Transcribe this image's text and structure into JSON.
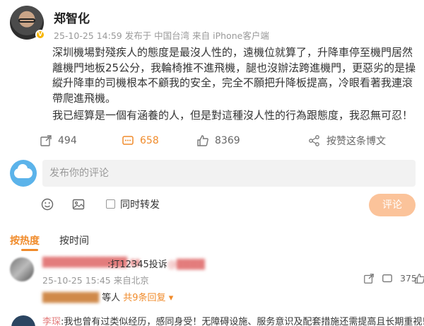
{
  "post": {
    "username": "郑智化",
    "meta": "25-10-25 14:59 发布于 中国台湾 来自 iPhone客户端",
    "paragraphs": [
      "深圳機場對殘疾人的態度是最沒人性的，遠機位就算了，升降車停至機門居然離機門地板25公分，我輪椅推不進飛機，腿也沒辦法跨進機門，更惡劣的是操縱升降車的司機根本不顧我的安全，完全不願把升降板提高，冷眼看著我連滾帶爬進飛機。",
      "我已經算是一個有涵養的人，但是對這種沒人性的行為跟態度，我忍無可忍！"
    ]
  },
  "actions": {
    "repost_count": "494",
    "comment_count": "658",
    "like_count": "8369",
    "more_label": "按赞这条博文"
  },
  "composer": {
    "placeholder": "发布你的评论",
    "checkbox_label": "同时转发",
    "submit_label": "评论"
  },
  "sort": {
    "hot_label": "按热度",
    "time_label": "按时间"
  },
  "comments": [
    {
      "text": ":打12345投诉",
      "meta": "25-10-25 15:45 来自北京",
      "likes": "375",
      "replies_suffix": "等人",
      "replies_link": "共9条回复"
    },
    {
      "user": "李琛",
      "text": ":我也曾有过类似经历，感同身受！无障碍设施、服务意识及配套措施还需提高且长期重视!"
    }
  ],
  "colors": {
    "accent": "#f08b2b",
    "submit_bg": "#fbc39a",
    "input_bg": "#f2f2f2",
    "muted": "#999999"
  }
}
